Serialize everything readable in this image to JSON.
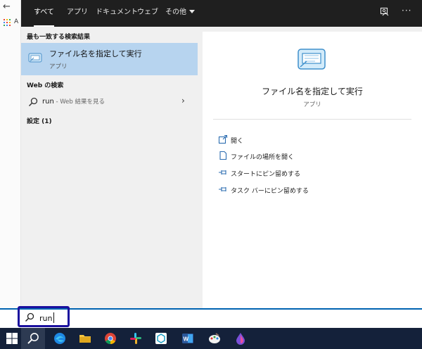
{
  "background": {
    "back_glyph": "←",
    "tab_initial": "A"
  },
  "search": {
    "tabs": [
      "すべて",
      "アプリ",
      "ドキュメント",
      "ウェブ",
      "その他"
    ],
    "more_glyph": "···",
    "best_match": {
      "section": "最も一致する検索結果",
      "title": "ファイル名を指定して実行",
      "subtitle": "アプリ"
    },
    "web": {
      "section": "Web の検索",
      "query": "run",
      "suffix": " - Web 結果を見る"
    },
    "settings_section": "設定 (1)",
    "detail": {
      "title": "ファイル名を指定して実行",
      "subtitle": "アプリ",
      "actions": [
        "開く",
        "ファイルの場所を開く",
        "スタートにピン留めする",
        "タスク バーにピン留めする"
      ]
    },
    "input_value": "run"
  },
  "colors": {
    "accent": "#0063b1",
    "highlight": "#b7d4ef",
    "annotation_box": "#1a0f9e",
    "taskbar": "#14213a"
  },
  "taskbar": {
    "icons": [
      "windows-logo",
      "search",
      "edge",
      "file-explorer",
      "chrome",
      "slack",
      "teams-like",
      "word",
      "paint",
      "app"
    ]
  }
}
